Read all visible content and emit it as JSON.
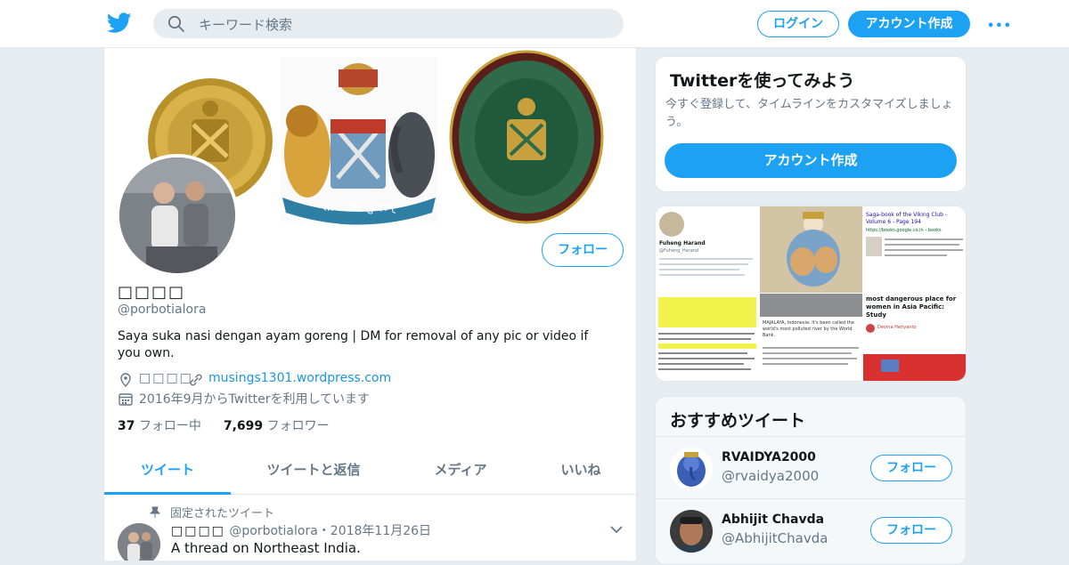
{
  "header": {
    "search_placeholder": "キーワード検索",
    "login_label": "ログイン",
    "signup_label": "アカウント作成",
    "more_label": "•••"
  },
  "profile": {
    "name": "□□□□",
    "handle": "@porbotialora",
    "follow_label": "フォロー",
    "bio": "Saya suka nasi dengan ayam goreng | DM for removal of any pic or video if you own.",
    "location": "□□□□",
    "website": "musings1301.wordpress.com",
    "joined": "2016年9月からTwitterを利用しています",
    "following_count": "37",
    "following_label": "フォロー中",
    "followers_count": "7,699",
    "followers_label": "フォロワー",
    "banner_motto": "सत्यं शिवं सुन्दरम्"
  },
  "tabs": [
    {
      "label": "ツイート",
      "active": true
    },
    {
      "label": "ツイートと返信",
      "active": false
    },
    {
      "label": "メディア",
      "active": false
    },
    {
      "label": "いいね",
      "active": false
    }
  ],
  "pinned_tweet": {
    "pinned_label": "固定されたツイート",
    "name": "□□□□",
    "handle": "@porbotialora",
    "date": "・2018年11月26日",
    "text": "A thread on Northeast India."
  },
  "signup_card": {
    "title": "Twitterを使ってみよう",
    "description": "今すぐ登録して、タイムラインをカスタマイズしましょう。",
    "button_label": "アカウント作成"
  },
  "media_grid": {
    "tile_a_name": "Fuheng Harand",
    "tile_a_handle": "@Fuheng_Harand",
    "tile_c_title": "Saga-book of the Viking Club - Volume 6 - Page 194",
    "tile_c_url": "https://books.google.co.in › books",
    "tile_f_title": "most dangerous place for women in Asia Pacific: Study",
    "tile_f_source": "Devina Heriyanto",
    "tile_e_text": "MAJALAYA, Indonesia: It's been called the world's most polluted river by the World Bank."
  },
  "recommended": {
    "title": "おすすめツイート",
    "accounts": [
      {
        "name": "RVAIDYA2000",
        "handle": "@rvaidya2000",
        "follow_label": "フォロー"
      },
      {
        "name": "Abhijit Chavda",
        "handle": "@AbhijitChavda",
        "follow_label": "フォロー"
      }
    ]
  },
  "colors": {
    "accent": "#1da1f2",
    "background": "#e6ecf0",
    "text_secondary": "#657786"
  }
}
